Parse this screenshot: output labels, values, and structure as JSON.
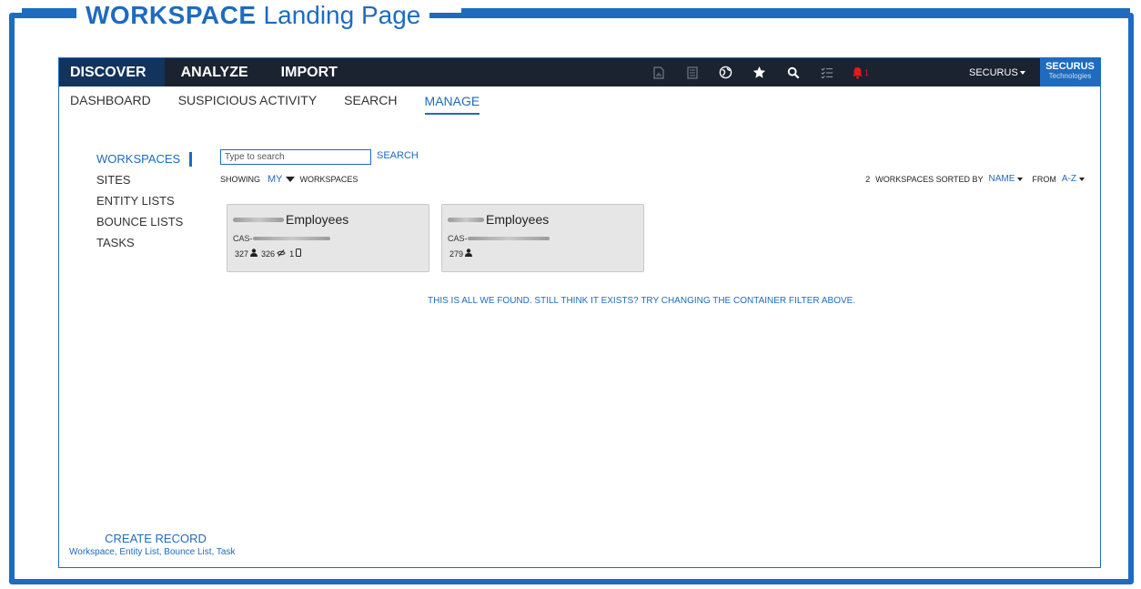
{
  "frame": {
    "title_bold": "WORKSPACE",
    "title_light": "Landing Page"
  },
  "topnav": {
    "items": [
      "DISCOVER",
      "ANALYZE",
      "IMPORT"
    ]
  },
  "toolbar_icons": [
    "document-icon",
    "list-icon",
    "globe-icon",
    "star-icon",
    "search-icon",
    "checklist-icon",
    "bell-icon"
  ],
  "notifications": {
    "count": "1"
  },
  "user": {
    "name": "SECURUS"
  },
  "logo": {
    "line1": "SECURUS",
    "line2": "Technologies"
  },
  "subnav": {
    "items": [
      "DASHBOARD",
      "SUSPICIOUS ACTIVITY",
      "SEARCH",
      "MANAGE"
    ],
    "active": "MANAGE"
  },
  "sidebar": {
    "items": [
      "WORKSPACES",
      "SITES",
      "ENTITY LISTS",
      "BOUNCE LISTS",
      "TASKS"
    ]
  },
  "search": {
    "value": "Type to search",
    "button": "SEARCH"
  },
  "filter": {
    "showing": "SHOWING",
    "scope": "MY",
    "suffix": "WORKSPACES"
  },
  "sort": {
    "count": "2",
    "label": "WORKSPACES SORTED BY",
    "field": "NAME",
    "from": "FROM",
    "order": "A-Z"
  },
  "cards": [
    {
      "name": "Employees",
      "code_prefix": "CAS-",
      "users": "327",
      "hidden": "326",
      "devices": "1"
    },
    {
      "name": "Employees",
      "code_prefix": "CAS-",
      "users": "279"
    }
  ],
  "message": "THIS IS ALL WE FOUND. STILL THINK IT EXISTS? TRY CHANGING THE CONTAINER FILTER ABOVE.",
  "create": {
    "title": "CREATE RECORD",
    "options": "Workspace, Entity List, Bounce List, Task"
  },
  "colors": {
    "accent": "#1e6bbf",
    "topbar": "#1b2230",
    "active_nav": "#12335c",
    "alert": "#e21b1b",
    "card": "#e6e6e6"
  }
}
